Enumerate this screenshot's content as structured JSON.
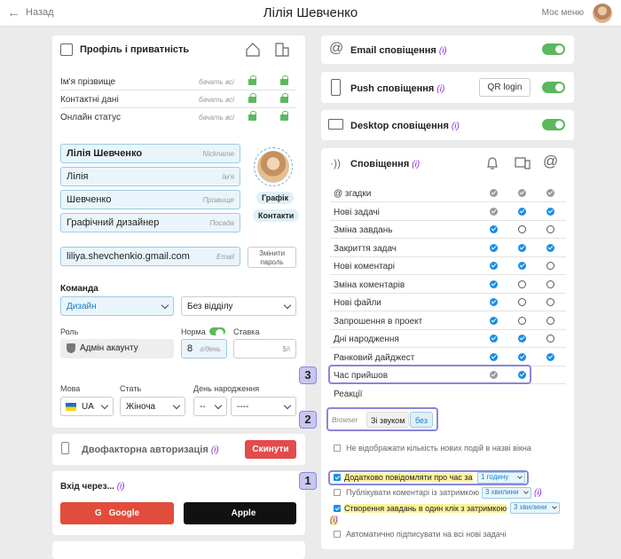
{
  "header": {
    "back_label": "Назад",
    "title": "Лілія Шевченко",
    "menu_label": "Моє меню"
  },
  "profile": {
    "title": "Профіль і приватність",
    "rows": [
      {
        "label": "Ім'я прізвище",
        "hint": "бачать всі"
      },
      {
        "label": "Контактні дані",
        "hint": "бачать всі"
      },
      {
        "label": "Онлайн статус",
        "hint": "бачать всі"
      }
    ],
    "fields": {
      "nickname": {
        "value": "Лілія Шевченко",
        "placeholder": "Nickname"
      },
      "first": {
        "value": "Лілія",
        "placeholder": "Ім'я"
      },
      "last": {
        "value": "Шевченко",
        "placeholder": "Прізвище"
      },
      "position": {
        "value": "Графічний дизайнер",
        "placeholder": "Посада"
      },
      "email": {
        "value": "liliya.shevchenkio.gmail.com",
        "placeholder": "Email"
      }
    },
    "schedule_label": "Графік",
    "contacts_label": "Контакти",
    "change_password": "Змінити пароль",
    "team_label": "Команда",
    "team_value": "Дизайн",
    "dept_value": "Без відділу",
    "role_label": "Роль",
    "role_value": "Адмін акаунту",
    "norm_label": "Норма",
    "norm_value": "8",
    "norm_unit": "г/день",
    "rate_label": "Ставка",
    "rate_unit": "$/і",
    "lang_label": "Мова",
    "lang_value": "UA",
    "gender_label": "Стать",
    "gender_value": "Жіноча",
    "birthday_label": "День народження",
    "bday_day": "--",
    "bday_month": "----"
  },
  "twofa": {
    "title": "Двофакторна авторизація",
    "info": "(і)",
    "reset": "Скинути"
  },
  "login": {
    "title": "Вхід через...",
    "info": "(і)",
    "google": "Google",
    "apple": "Apple"
  },
  "email_notif": {
    "title": "Email сповіщення",
    "info": "(і)"
  },
  "push_notif": {
    "title": "Push сповіщення",
    "info": "(і)",
    "qr": "QR login"
  },
  "desktop_notif": {
    "title": "Desktop сповіщення",
    "info": "(і)"
  },
  "notifications": {
    "title": "Сповіщення",
    "info": "(і)",
    "rows": [
      {
        "label": "@ згадки",
        "c": [
          "gr",
          "gr",
          "gr"
        ]
      },
      {
        "label": "Нові задачі",
        "c": [
          "gr",
          "on",
          "on"
        ]
      },
      {
        "label": "Зміна завдань",
        "c": [
          "on",
          "off",
          "off"
        ]
      },
      {
        "label": "Закриття задач",
        "c": [
          "on",
          "on",
          "on"
        ]
      },
      {
        "label": "Нові коментарі",
        "c": [
          "on",
          "on",
          "off"
        ]
      },
      {
        "label": "Зміна коментарів",
        "c": [
          "on",
          "off",
          "off"
        ]
      },
      {
        "label": "Нові файли",
        "c": [
          "on",
          "off",
          "off"
        ]
      },
      {
        "label": "Запрошення в проект",
        "c": [
          "on",
          "off",
          "off"
        ]
      },
      {
        "label": "Дні народження",
        "c": [
          "on",
          "on",
          "off"
        ]
      },
      {
        "label": "Ранковий дайджест",
        "c": [
          "on",
          "on",
          "on"
        ]
      },
      {
        "label": "Час прийшов",
        "c": [
          "gr",
          "on",
          ""
        ]
      },
      {
        "label": "Реакції",
        "c": [
          "",
          "",
          ""
        ]
      }
    ],
    "browser_label": "Browser",
    "sound_on": "Зі звуком",
    "sound_off": "без",
    "hide_count": "Не відображати кількість нових подій в назві вікна",
    "extra_notify": "Додатково повідомляти про час за",
    "extra_value": "1 годину",
    "delay_comments": "Публікувати коментарі із затримкою",
    "delay_value": "3 хвилини",
    "delay_info": "(і)",
    "oneclick": "Створення завдань в один клік з затримкою",
    "oneclick_value": "3 хвилини",
    "oneclick_info": "(і)",
    "autosign": "Автоматично підписувати на всі нові задачі"
  },
  "badges": {
    "one": "1",
    "two": "2",
    "three": "3"
  },
  "colors": {
    "accent": "#1a8fe3",
    "green": "#5cb85c",
    "red": "#e24c4b",
    "highlight": "#8a86d8"
  }
}
